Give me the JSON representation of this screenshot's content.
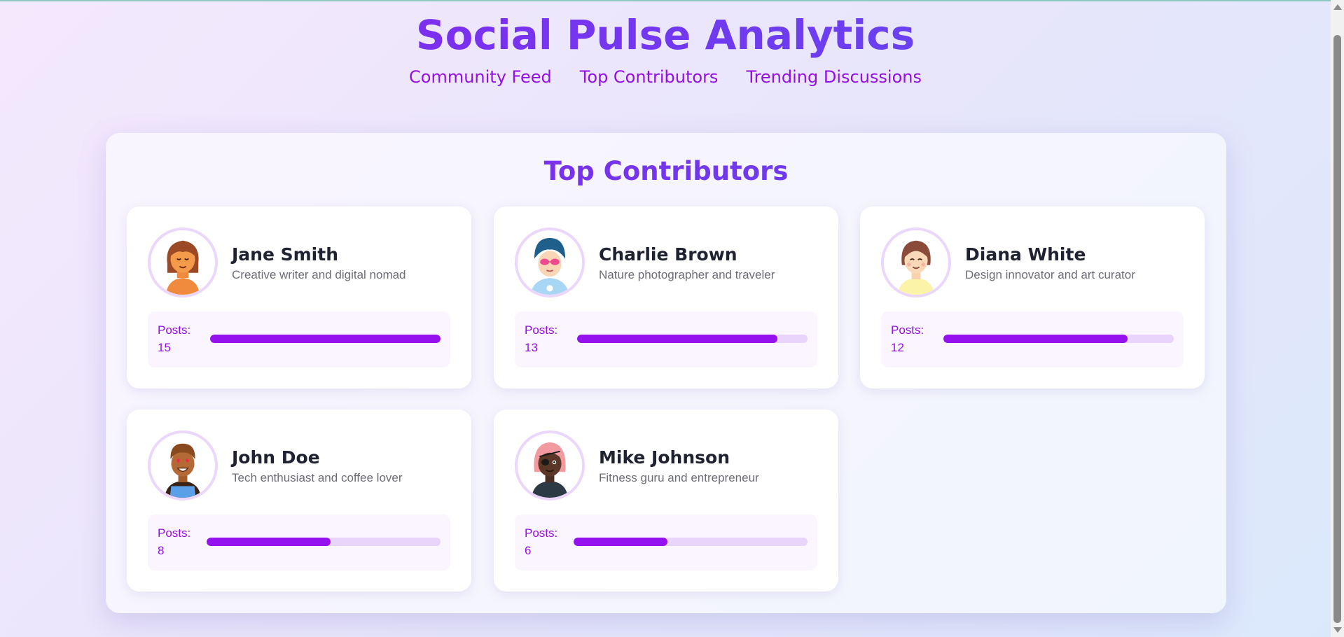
{
  "header": {
    "title": "Social Pulse Analytics",
    "nav": [
      "Community Feed",
      "Top Contributors",
      "Trending Discussions"
    ]
  },
  "section": {
    "title": "Top Contributors"
  },
  "contributors": [
    {
      "name": "Jane Smith",
      "bio": "Creative writer and digital nomad",
      "posts_label": "Posts:",
      "posts": "15",
      "activity_level": 1.0
    },
    {
      "name": "Charlie Brown",
      "bio": "Nature photographer and traveler",
      "posts_label": "Posts:",
      "posts": "13",
      "activity_level": 0.87
    },
    {
      "name": "Diana White",
      "bio": "Design innovator and art curator",
      "posts_label": "Posts:",
      "posts": "12",
      "activity_level": 0.8
    },
    {
      "name": "John Doe",
      "bio": "Tech enthusiast and coffee lover",
      "posts_label": "Posts:",
      "posts": "8",
      "activity_level": 0.53
    },
    {
      "name": "Mike Johnson",
      "bio": "Fitness guru and entrepreneur",
      "posts_label": "Posts:",
      "posts": "6",
      "activity_level": 0.4
    }
  ],
  "colors": {
    "accent": "#9410e2",
    "bar_fill": "#9512ee",
    "bar_track": "#e9d4fb"
  },
  "icons": [
    "avatar-jane-icon",
    "avatar-charlie-icon",
    "avatar-diana-icon",
    "avatar-john-icon",
    "avatar-mike-icon"
  ]
}
